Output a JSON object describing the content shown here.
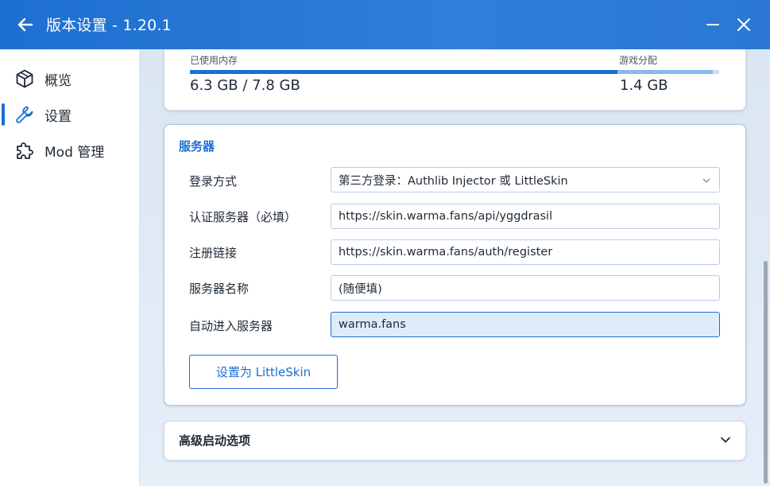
{
  "window": {
    "title": "版本设置 - 1.20.1",
    "back_icon": "arrow-left-icon",
    "minimize_icon": "minimize-icon",
    "close_icon": "close-icon"
  },
  "sidebar": {
    "items": [
      {
        "label": "概览",
        "icon": "cube-icon",
        "active": false
      },
      {
        "label": "设置",
        "icon": "wrench-icon",
        "active": true
      },
      {
        "label": "Mod 管理",
        "icon": "puzzle-icon",
        "active": false
      }
    ]
  },
  "memory": {
    "used_label": "已使用内存",
    "used_value": "6.3 GB / 7.8 GB",
    "alloc_label": "游戏分配",
    "alloc_value": "1.4 GB"
  },
  "server": {
    "title": "服务器",
    "login_method_label": "登录方式",
    "login_method_value": "第三方登录：Authlib Injector 或 LittleSkin",
    "auth_server_label": "认证服务器（必填）",
    "auth_server_value": "https://skin.warma.fans/api/yggdrasil",
    "register_link_label": "注册链接",
    "register_link_value": "https://skin.warma.fans/auth/register",
    "server_name_label": "服务器名称",
    "server_name_value": "(随便填)",
    "auto_join_label": "自动进入服务器",
    "auto_join_value": "warma.fans",
    "littleskin_button": "设置为 LittleSkin"
  },
  "advanced": {
    "title": "高级启动选项"
  },
  "colors": {
    "accent": "#1b6fd2",
    "titlebar": "#2a78d4"
  }
}
